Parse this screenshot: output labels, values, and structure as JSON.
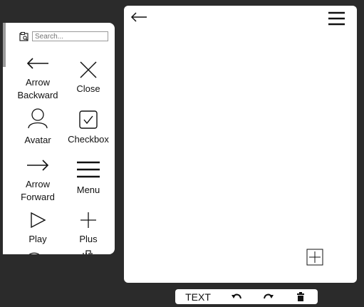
{
  "palette": {
    "search": {
      "placeholder": "Search..."
    },
    "items": [
      {
        "label_line1": "Arrow",
        "label_line2": "Backward",
        "icon": "arrow-left-icon"
      },
      {
        "label_line1": "Close",
        "label_line2": "",
        "icon": "close-icon"
      },
      {
        "label_line1": "Avatar",
        "label_line2": "",
        "icon": "avatar-icon"
      },
      {
        "label_line1": "Checkbox",
        "label_line2": "",
        "icon": "checkbox-icon"
      },
      {
        "label_line1": "Arrow",
        "label_line2": "Forward",
        "icon": "arrow-right-icon"
      },
      {
        "label_line1": "Menu",
        "label_line2": "",
        "icon": "menu-icon"
      },
      {
        "label_line1": "Play",
        "label_line2": "",
        "icon": "play-icon"
      },
      {
        "label_line1": "Plus",
        "label_line2": "",
        "icon": "plus-icon"
      }
    ]
  },
  "canvas": {
    "icons": [
      "arrow-left-icon",
      "hamburger-menu-icon",
      "plus-box-icon"
    ]
  },
  "toolbar": {
    "text_label": "TEXT",
    "icons": [
      "undo-icon",
      "redo-icon",
      "trash-icon"
    ]
  },
  "colors": {
    "background": "#2b2b2b",
    "panel": "#ffffff",
    "ink": "#111111"
  }
}
